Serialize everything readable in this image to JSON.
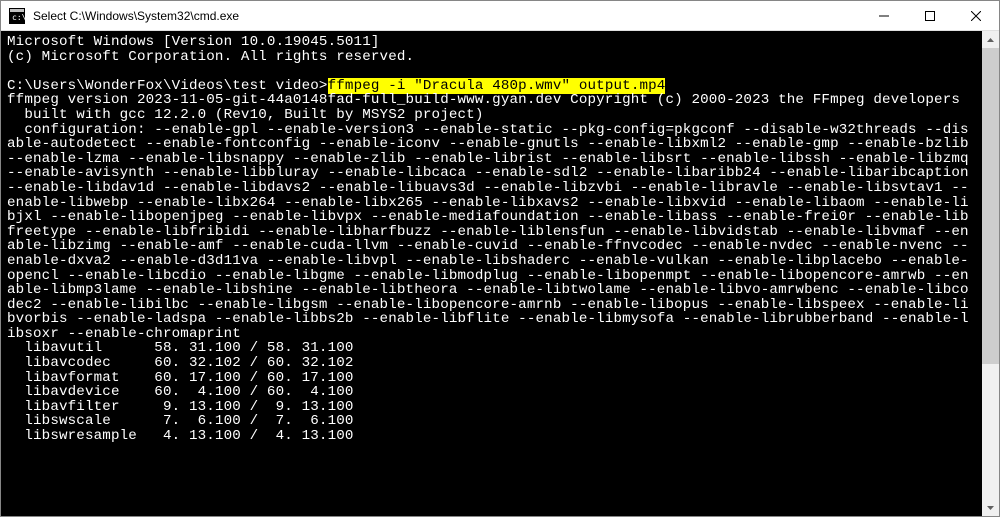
{
  "titlebar": {
    "icon_name": "cmd-icon",
    "title": "Select C:\\Windows\\System32\\cmd.exe"
  },
  "window_controls": {
    "minimize_glyph": "─",
    "maximize_glyph": "☐",
    "close_glyph": "✕"
  },
  "terminal": {
    "line_os": "Microsoft Windows [Version 10.0.19045.5011]",
    "line_copyright": "(c) Microsoft Corporation. All rights reserved.",
    "blank": "",
    "prompt_path": "C:\\Users\\WonderFox\\Videos\\test video>",
    "highlighted_cmd": "ffmpeg -i \"Dracula 480p.wmv\" output.mp4",
    "ffmpeg_version": "ffmpeg version 2023-11-05-git-44a0148fad-full_build-www.gyan.dev Copyright (c) 2000-2023 the FFmpeg developers",
    "built_with": "  built with gcc 12.2.0 (Rev10, Built by MSYS2 project)",
    "config_block": "  configuration: --enable-gpl --enable-version3 --enable-static --pkg-config=pkgconf --disable-w32threads --disable-autodetect --enable-fontconfig --enable-iconv --enable-gnutls --enable-libxml2 --enable-gmp --enable-bzlib --enable-lzma --enable-libsnappy --enable-zlib --enable-librist --enable-libsrt --enable-libssh --enable-libzmq --enable-avisynth --enable-libbluray --enable-libcaca --enable-sdl2 --enable-libaribb24 --enable-libaribcaption --enable-libdav1d --enable-libdavs2 --enable-libuavs3d --enable-libzvbi --enable-libravle --enable-libsvtav1 --enable-libwebp --enable-libx264 --enable-libx265 --enable-libxavs2 --enable-libxvid --enable-libaom --enable-libjxl --enable-libopenjpeg --enable-libvpx --enable-mediafoundation --enable-libass --enable-frei0r --enable-libfreetype --enable-libfribidi --enable-libharfbuzz --enable-liblensfun --enable-libvidstab --enable-libvmaf --enable-libzimg --enable-amf --enable-cuda-llvm --enable-cuvid --enable-ffnvcodec --enable-nvdec --enable-nvenc --enable-dxva2 --enable-d3d11va --enable-libvpl --enable-libshaderc --enable-vulkan --enable-libplacebo --enable-opencl --enable-libcdio --enable-libgme --enable-libmodplug --enable-libopenmpt --enable-libopencore-amrwb --enable-libmp3lame --enable-libshine --enable-libtheora --enable-libtwolame --enable-libvo-amrwbenc --enable-libcodec2 --enable-libilbc --enable-libgsm --enable-libopencore-amrnb --enable-libopus --enable-libspeex --enable-libvorbis --enable-ladspa --enable-libbs2b --enable-libflite --enable-libmysofa --enable-librubberband --enable-libsoxr --enable-chromaprint",
    "lib_rows": [
      "  libavutil      58. 31.100 / 58. 31.100",
      "  libavcodec     60. 32.102 / 60. 32.102",
      "  libavformat    60. 17.100 / 60. 17.100",
      "  libavdevice    60.  4.100 / 60.  4.100",
      "  libavfilter     9. 13.100 /  9. 13.100",
      "  libswscale      7.  6.100 /  7.  6.100",
      "  libswresample   4. 13.100 /  4. 13.100"
    ]
  }
}
